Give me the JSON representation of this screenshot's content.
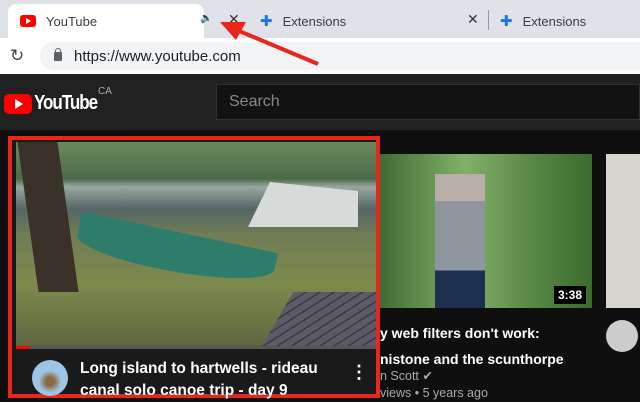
{
  "tabs": [
    {
      "title": "YouTube",
      "active": true,
      "audio": true
    },
    {
      "title": "Extensions"
    },
    {
      "title": "Extensions"
    }
  ],
  "address": {
    "url": "https://www.youtube.com"
  },
  "youtube": {
    "logo": "YouTube",
    "region": "CA",
    "search_placeholder": "Search"
  },
  "videos": [
    {
      "title_line1": "Long island to hartwells - rideau",
      "title_line2": "canal solo canoe trip - day 9",
      "progress_percent": 4
    },
    {
      "title_line1": "y web filters don't work:",
      "title_line2": "nistone and the scunthorpe",
      "channel": "n Scott",
      "meta": "views • 5 years ago",
      "duration": "3:38"
    }
  ],
  "colors": {
    "highlight": "#e8261c",
    "accent": "#ff0000"
  }
}
